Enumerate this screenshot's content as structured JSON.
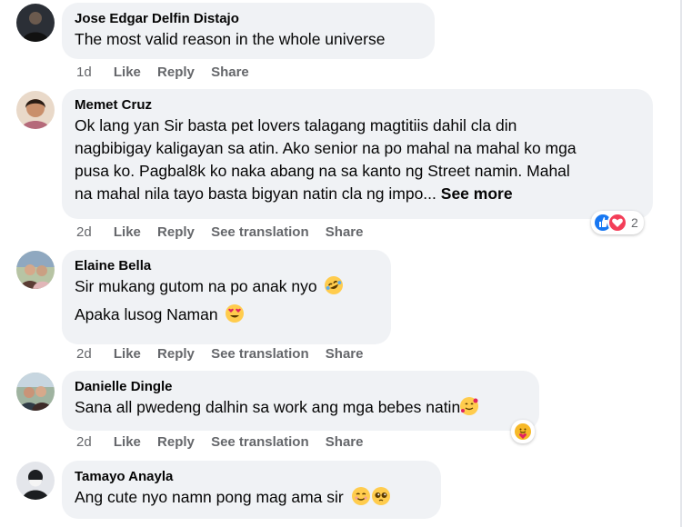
{
  "comments": [
    {
      "author": "Jose Edgar Delfin Distajo",
      "lines": [
        "The most valid reason in the whole universe"
      ],
      "actions": {
        "time": "1d",
        "like": "Like",
        "reply": "Reply",
        "share": "Share"
      }
    },
    {
      "author": "Memet Cruz",
      "lines": [
        "Ok lang yan Sir basta pet lovers talagang magtitiis dahil cla din",
        "nagbibigay kaligayan sa atin. Ako senior na po mahal na mahal ko mga",
        "pusa ko. Pagbal8k ko naka abang na sa kanto ng Street namin. Mahal",
        "na mahal nila tayo basta bigyan natin cla ng impo..."
      ],
      "see_more": "See more",
      "reaction_count": "2",
      "actions": {
        "time": "2d",
        "like": "Like",
        "reply": "Reply",
        "translate": "See translation",
        "share": "Share"
      }
    },
    {
      "author": "Elaine Bella",
      "lines": [
        "Sir mukang gutom na po anak nyo",
        "Apaka lusog Naman"
      ],
      "actions": {
        "time": "2d",
        "like": "Like",
        "reply": "Reply",
        "translate": "See translation",
        "share": "Share"
      }
    },
    {
      "author": "Danielle Dingle",
      "lines": [
        "Sana all pwedeng dalhin sa work ang mga bebes natin"
      ],
      "actions": {
        "time": "2d",
        "like": "Like",
        "reply": "Reply",
        "translate": "See translation",
        "share": "Share"
      }
    },
    {
      "author": "Tamayo Anayla",
      "lines": [
        "Ang cute nyo namn pong mag ama sir"
      ]
    }
  ],
  "colors": {
    "bubble": "#f0f2f5",
    "secondary_text": "#65676b",
    "like_blue": "#1877f2",
    "love_red": "#f33e58"
  }
}
